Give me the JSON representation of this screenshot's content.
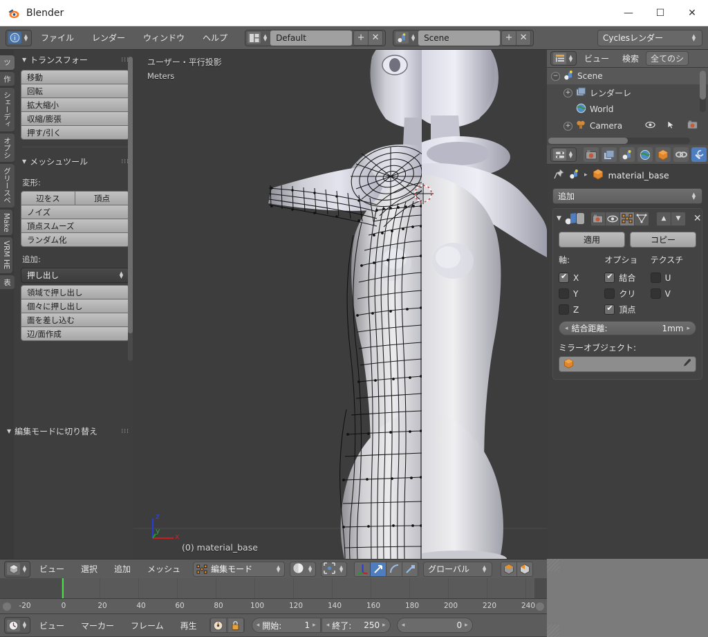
{
  "window": {
    "title": "Blender",
    "app_icon": "blender-logo-icon",
    "minimize": "—",
    "maximize": "☐",
    "close": "✕"
  },
  "topbar": {
    "editor_icon": "info-editor-icon",
    "menus": [
      "ファイル",
      "レンダー",
      "ウィンドウ",
      "ヘルプ"
    ],
    "screen_layout": {
      "icon": "screen-layout-icon",
      "value": "Default",
      "add_label": "+",
      "remove_label": "✕"
    },
    "scene": {
      "icon": "scene-icon",
      "value": "Scene",
      "add_label": "+",
      "remove_label": "✕"
    },
    "render_engine": {
      "value": "Cyclesレンダー",
      "arrow": "↕"
    }
  },
  "toolshelf": {
    "tabs": [
      {
        "label": "ツ",
        "active": true
      },
      {
        "label": "作",
        "active": false
      },
      {
        "label": "シェーディ",
        "active": false
      },
      {
        "label": "オプシ",
        "active": false
      },
      {
        "label": "グリースペ",
        "active": false
      },
      {
        "label": "Make",
        "active": false
      },
      {
        "label": "VRM HE",
        "active": false
      },
      {
        "label": "表",
        "active": false
      }
    ],
    "transform_panel": {
      "title": "トランスフォー",
      "buttons": [
        "移動",
        "回転",
        "拡大縮小",
        "収縮/膨張",
        "押す/引く"
      ]
    },
    "mesh_tools_panel": {
      "title": "メッシュツール",
      "deform_label": "変形:",
      "deform_pair": [
        "辺をス",
        "頂点"
      ],
      "deform_buttons": [
        "ノイズ",
        "頂点スムーズ",
        "ランダム化"
      ],
      "add_label": "追加:",
      "add_dropdown": "押し出し",
      "add_buttons": [
        "領域で押し出し",
        "個々に押し出し",
        "面を差し込む",
        "辺/面作成"
      ]
    },
    "bottom_panel": {
      "title": "編集モードに切り替え"
    }
  },
  "viewport": {
    "view_info": "ユーザー・平行投影",
    "units": "Meters",
    "object_info": "(0) material_base",
    "axis_gizmo": {
      "z": "z",
      "y": "y",
      "x": "x"
    },
    "background_color": "#3d3d3d"
  },
  "outliner": {
    "editor_icon": "outliner-editor-icon",
    "menus": [
      "ビュー",
      "検索"
    ],
    "filter": "全てのシ",
    "rows": [
      {
        "label": "Scene",
        "icon": "scene-icon",
        "indent": 0,
        "selected": true,
        "expander": "−"
      },
      {
        "label": "レンダーレ",
        "icon": "renderlayer-icon",
        "indent": 1,
        "selected": false,
        "expander": "+"
      },
      {
        "label": "World",
        "icon": "world-icon",
        "indent": 1,
        "selected": false,
        "expander": ""
      },
      {
        "label": "Camera",
        "icon": "camera-icon",
        "indent": 1,
        "selected": false,
        "expander": "+"
      }
    ],
    "row_icons": [
      "eye-icon",
      "cursor-icon",
      "render-icon"
    ]
  },
  "properties": {
    "tabs": [
      {
        "name": "render-tab",
        "icon": "camera-back-icon",
        "active": false
      },
      {
        "name": "renderlayers-tab",
        "icon": "images-icon",
        "active": false
      },
      {
        "name": "scene-tab",
        "icon": "scene-icon",
        "active": false
      },
      {
        "name": "world-tab",
        "icon": "world-globe-icon",
        "active": false
      },
      {
        "name": "object-tab",
        "icon": "orange-cube-icon",
        "active": false
      },
      {
        "name": "constraints-tab",
        "icon": "chain-link-icon",
        "active": false
      },
      {
        "name": "modifiers-tab",
        "icon": "wrench-icon",
        "active": true
      }
    ],
    "breadcrumb": {
      "pin_icon": "pin-icon",
      "scene_icon": "scene-icon",
      "separator": "▸",
      "object_icon": "orange-cube-icon",
      "object_name": "material_base"
    },
    "add_modifier": {
      "label": "追加",
      "arrow": "↕"
    },
    "modifier": {
      "collapse_icon": "triangle-down-icon",
      "type_icon": "mirror-modifier-icon",
      "name": "",
      "display_toggles": [
        "render-toggle-icon",
        "viewport-eye-icon",
        "editmode-toggle-icon",
        "cage-toggle-icon"
      ],
      "move_up": "▲",
      "move_down": "▼",
      "delete": "✕",
      "apply_label": "適用",
      "copy_label": "コピー",
      "columns": [
        {
          "header": "軸:",
          "items": [
            {
              "label": "X",
              "checked": true
            },
            {
              "label": "Y",
              "checked": false
            },
            {
              "label": "Z",
              "checked": false
            }
          ]
        },
        {
          "header": "オプショ",
          "items": [
            {
              "label": "結合",
              "checked": true
            },
            {
              "label": "クリ",
              "checked": false
            },
            {
              "label": "頂点",
              "checked": true
            }
          ]
        },
        {
          "header": "テクスチ",
          "items": [
            {
              "label": "U",
              "checked": false
            },
            {
              "label": "V",
              "checked": false
            }
          ]
        }
      ],
      "merge_limit": {
        "label": "結合距離:",
        "value": "1mm",
        "arrow_left": "◂",
        "arrow_right": "▸"
      },
      "mirror_object_label": "ミラーオブジェクト:",
      "mirror_object_value": "",
      "mirror_object_icon": "orange-cube-icon",
      "eyedropper_icon": "eyedropper-icon"
    }
  },
  "viewport_footer": {
    "editor_icon": "3dview-editor-icon",
    "menus": [
      "ビュー",
      "選択",
      "追加",
      "メッシュ"
    ],
    "mode": {
      "icon": "editmode-icon",
      "value": "編集モード",
      "arrow": "↕"
    },
    "shading": {
      "icon": "solid-shading-icon",
      "arrow": "↕"
    },
    "pivot": {
      "icon": "pivot-median-icon",
      "arrow": "↕"
    },
    "select_modes": [
      {
        "name": "vertex-select-icon",
        "active": false
      },
      {
        "name": "edge-select-icon",
        "active": false
      },
      {
        "name": "face-select-icon",
        "active": false
      }
    ],
    "manipulator_toggles": [
      {
        "name": "manipulator-icon",
        "active": false
      },
      {
        "name": "translate-manipulator-icon",
        "active": true
      },
      {
        "name": "rotate-manipulator-icon",
        "active": false
      },
      {
        "name": "scale-manipulator-icon",
        "active": false
      }
    ],
    "orientation": {
      "value": "グローバル",
      "arrow": "↕"
    },
    "layer_toggles": [
      "occlude-geometry-icon",
      "limit-selection-icon"
    ]
  },
  "timeline": {
    "ticks": [
      -20,
      0,
      20,
      40,
      60,
      80,
      100,
      120,
      140,
      160,
      180,
      200,
      220,
      240
    ],
    "playhead_frame": 0,
    "editor_icon": "timeline-editor-icon",
    "menus": [
      "ビュー",
      "マーカー",
      "フレーム",
      "再生"
    ],
    "toggles": [
      "auto-key-icon",
      "lock-icon"
    ],
    "start": {
      "label": "開始:",
      "value": "1"
    },
    "end": {
      "label": "終了:",
      "value": "250"
    },
    "current": {
      "label": "",
      "value": "0"
    }
  }
}
